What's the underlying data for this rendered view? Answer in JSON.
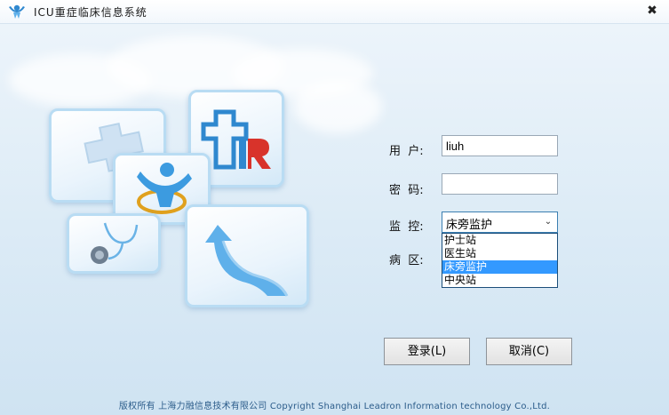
{
  "window": {
    "title": "ICU重症临床信息系统",
    "close_glyph": "✖"
  },
  "form": {
    "user_label": "用  户:",
    "user_value": "liuh",
    "password_label": "密  码:",
    "password_value": "",
    "monitor_label": "监  控:",
    "monitor_selected": "床旁监护",
    "ward_label": "病  区:",
    "monitor_options": [
      "护士站",
      "医生站",
      "床旁监护",
      "中央站"
    ],
    "monitor_highlighted_index": 2
  },
  "buttons": {
    "login": "登录(L)",
    "cancel": "取消(C)"
  },
  "footer": {
    "copyright": "版权所有 上海力融信息技术有限公司 Copyright Shanghai Leadron Information technology Co.,Ltd."
  },
  "colors": {
    "accent": "#3399ff",
    "tile_border": "#b9dcf3",
    "logo_red": "#d8332b",
    "logo_blue": "#2f88cf"
  },
  "icons": [
    "app-logo-icon",
    "close-icon",
    "medical-cross-icon",
    "lr-logo-icon",
    "person-icon",
    "stethoscope-icon",
    "arrow-up-icon",
    "chevron-down-icon"
  ]
}
